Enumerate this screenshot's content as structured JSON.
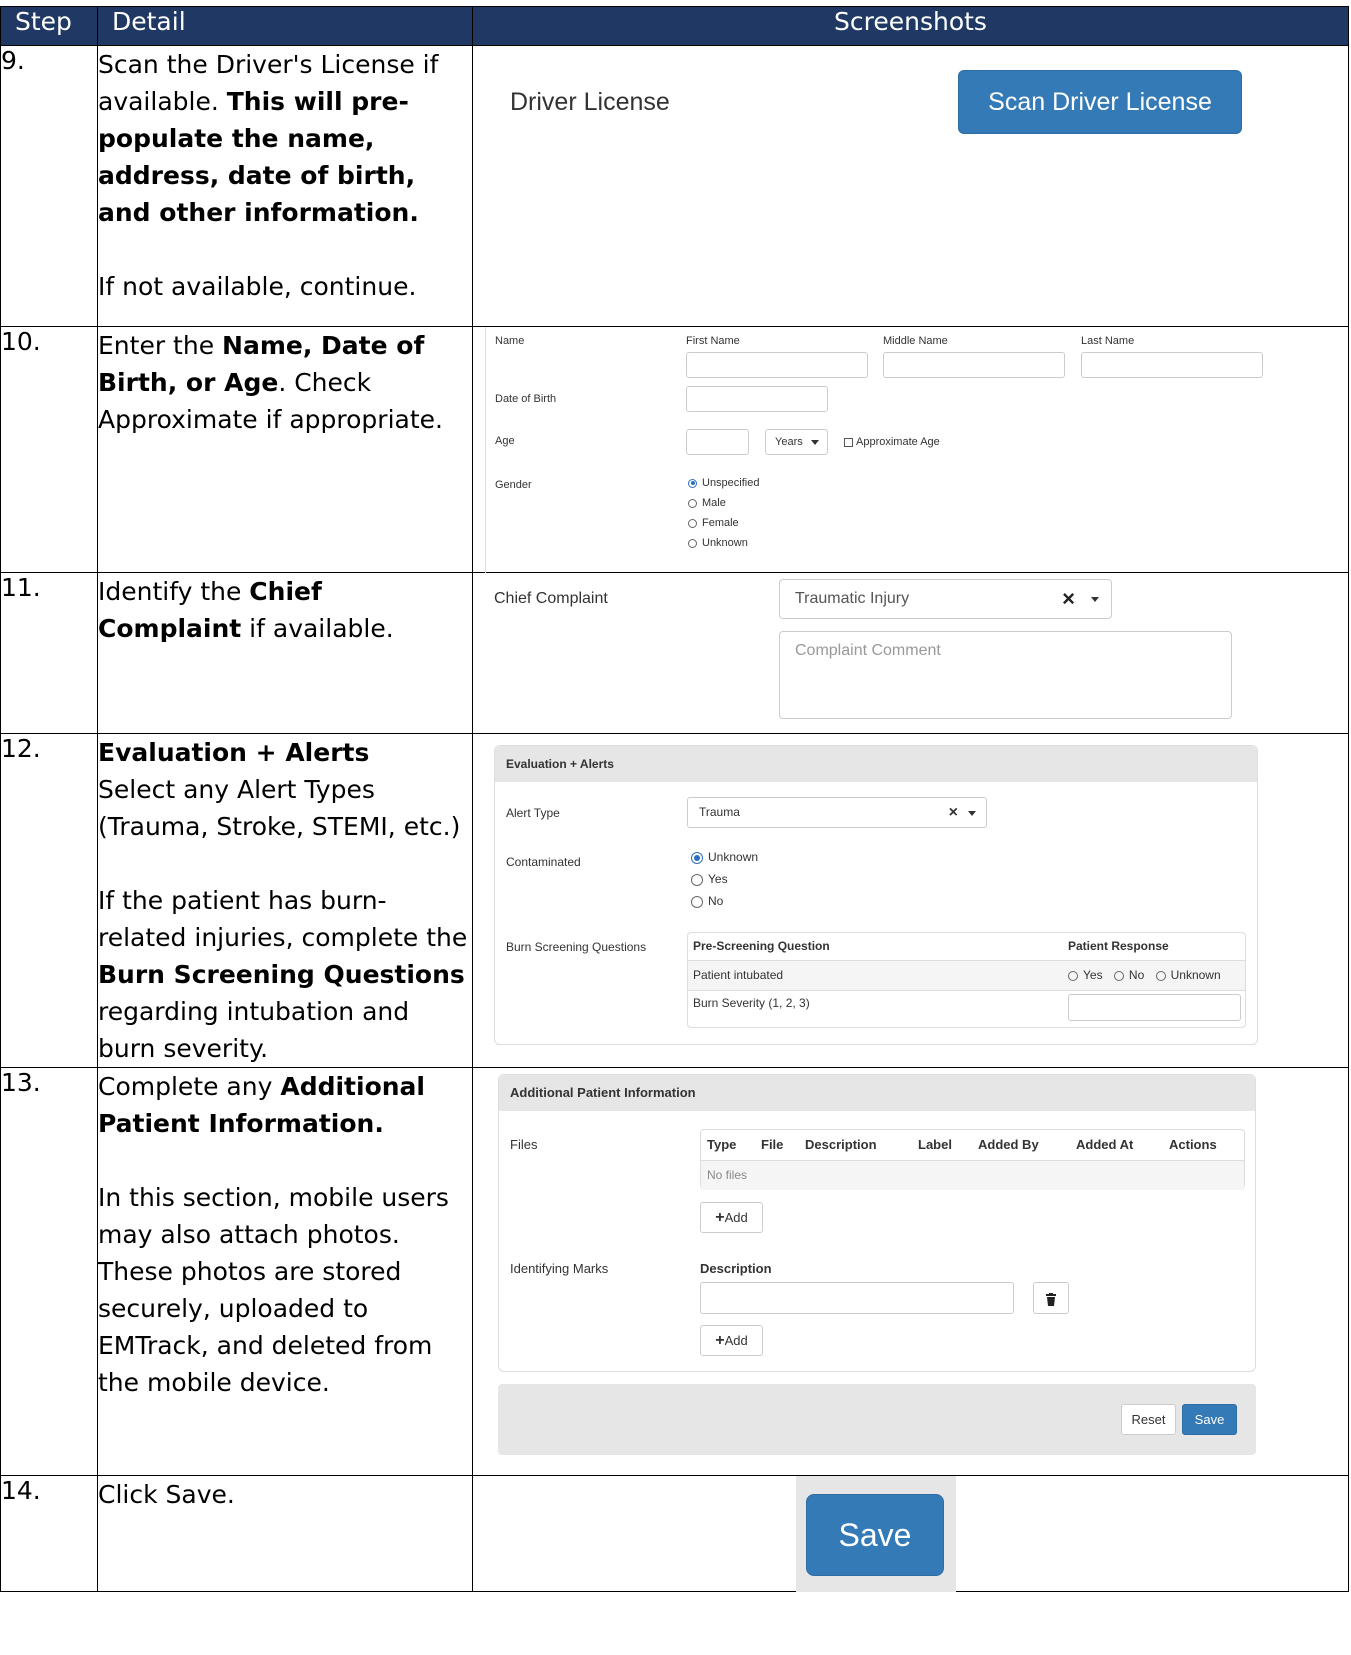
{
  "headers": {
    "step": "Step",
    "detail": "Detail",
    "screenshots": "Screenshots"
  },
  "rows": [
    {
      "step": "9.",
      "detail_html": "Scan the Driver's License if available. <b>This will pre-populate the name, address, date of birth, and other information.</b><br><br>If not available, continue."
    },
    {
      "step": "10.",
      "detail_html": "Enter the <b>Name, Date of Birth, or Age</b>. Check Approximate if appropriate."
    },
    {
      "step": "11.",
      "detail_html": "Identify the <b>Chief Complaint</b> if available."
    },
    {
      "step": "12.",
      "detail_html": "<b>Evaluation + Alerts</b><br>Select any Alert Types (Trauma, Stroke, STEMI, etc.)<br><br>If the patient has burn-related injuries, complete the <b>Burn Screening Questions</b> regarding intubation and burn severity."
    },
    {
      "step": "13.",
      "detail_html": "Complete any <b>Additional Patient Information.</b><br><br>In this section, mobile users may also attach photos. These photos are stored securely, uploaded to EMTrack, and deleted from the mobile device."
    },
    {
      "step": "14.",
      "detail_html": "Click Save."
    }
  ],
  "shot9": {
    "title": "Driver License",
    "button": "Scan Driver License"
  },
  "shot10": {
    "name_label": "Name",
    "first": "First Name",
    "middle": "Middle Name",
    "last": "Last Name",
    "dob": "Date of Birth",
    "age": "Age",
    "age_unit": "Years",
    "approx": "Approximate Age",
    "gender": "Gender",
    "gender_options": [
      "Unspecified",
      "Male",
      "Female",
      "Unknown"
    ],
    "gender_selected": "Unspecified"
  },
  "shot11": {
    "label": "Chief Complaint",
    "value": "Traumatic Injury",
    "clear": "×",
    "comment_placeholder": "Complaint Comment"
  },
  "shot12": {
    "panel_title": "Evaluation + Alerts",
    "alert_label": "Alert Type",
    "alert_value": "Trauma",
    "clear": "×",
    "contaminated_label": "Contaminated",
    "contaminated_options": [
      "Unknown",
      "Yes",
      "No"
    ],
    "contaminated_selected": "Unknown",
    "burn_label": "Burn Screening Questions",
    "col_question": "Pre-Screening Question",
    "col_response": "Patient Response",
    "q1": "Patient intubated",
    "q1_options": [
      "Yes",
      "No",
      "Unknown"
    ],
    "q2": "Burn Severity (1, 2, 3)"
  },
  "shot13": {
    "panel_title": "Additional Patient Information",
    "files_label": "Files",
    "columns": [
      "Type",
      "File",
      "Description",
      "Label",
      "Added By",
      "Added At",
      "Actions"
    ],
    "empty": "No files",
    "add": "Add",
    "marks_label": "Identifying Marks",
    "desc_label": "Description",
    "reset": "Reset",
    "save": "Save"
  },
  "shot14": {
    "save": "Save"
  }
}
